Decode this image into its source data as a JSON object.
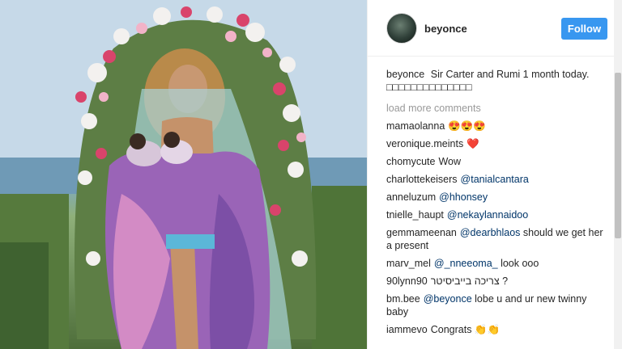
{
  "post": {
    "username": "beyonce",
    "follow_label": "Follow"
  },
  "caption": {
    "user": "beyonce",
    "text": "Sir Carter and Rumi 1 month today. □□□□□□□□□□□□□□"
  },
  "load_more": "load more comments",
  "comments": [
    {
      "user": "mamaolanna",
      "text": "😍😍😍",
      "mention": ""
    },
    {
      "user": "veronique.meints",
      "text": "❤️",
      "mention": ""
    },
    {
      "user": "chomycute",
      "text": "Wow",
      "mention": ""
    },
    {
      "user": "charlottekeisers",
      "text": "",
      "mention": "@tanialcantara"
    },
    {
      "user": "anneluzum",
      "text": "",
      "mention": "@hhonsey"
    },
    {
      "user": "tnielle_haupt",
      "text": "",
      "mention": "@nekaylannaidoo"
    },
    {
      "user": "gemmameenan",
      "text": "should we get her a present",
      "mention": "@dearbhlaos"
    },
    {
      "user": "marv_mel",
      "text": "look ooo",
      "mention": "@_nneeoma_"
    },
    {
      "user": "90lynn90",
      "text": "צריכה בייביסיטר ?",
      "mention": ""
    },
    {
      "user": "bm.bee",
      "text": "lobe u and ur new twinny baby",
      "mention": "@beyonce"
    },
    {
      "user": "iammevo",
      "text": "Congrats 👏👏",
      "mention": ""
    }
  ]
}
